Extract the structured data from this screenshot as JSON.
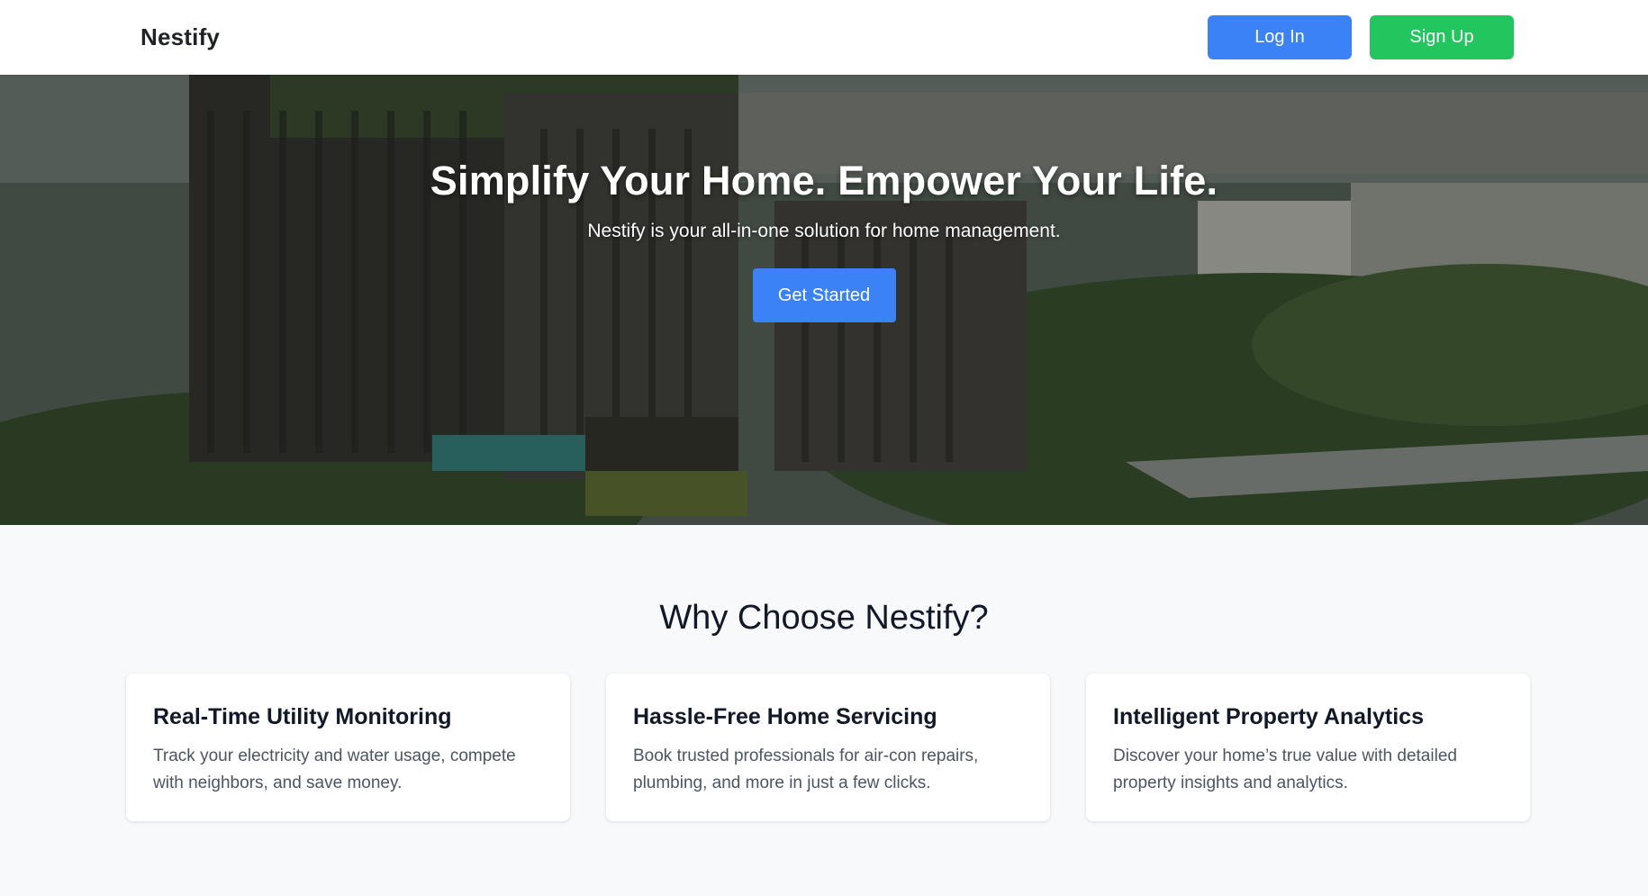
{
  "header": {
    "brand": "Nestify",
    "login_label": "Log In",
    "signup_label": "Sign Up"
  },
  "hero": {
    "title": "Simplify Your Home. Empower Your Life.",
    "subtitle": "Nestify is your all-in-one solution for home management.",
    "cta_label": "Get Started"
  },
  "features": {
    "title": "Why Choose Nestify?",
    "cards": [
      {
        "title": "Real-Time Utility Monitoring",
        "text": "Track your electricity and water usage, compete with neighbors, and save money."
      },
      {
        "title": "Hassle-Free Home Servicing",
        "text": "Book trusted professionals for air-con repairs, plumbing, and more in just a few clicks."
      },
      {
        "title": "Intelligent Property Analytics",
        "text": "Discover your home’s true value with detailed property insights and analytics."
      }
    ]
  },
  "colors": {
    "primary": "#3b82f6",
    "success": "#22c55e",
    "page_bg": "#f8f9fb"
  }
}
